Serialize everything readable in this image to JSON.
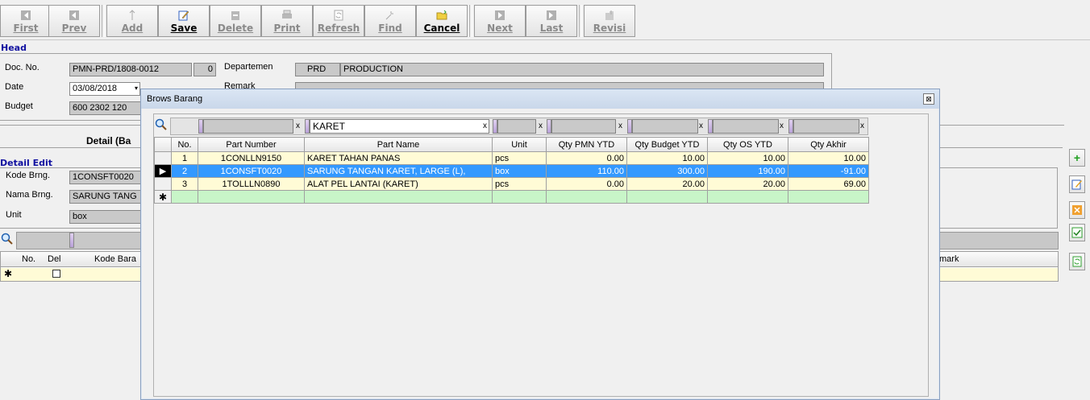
{
  "toolbar": {
    "buttons": [
      {
        "label": "First",
        "active": false
      },
      {
        "label": "Prev",
        "active": false
      },
      {
        "label": "Add",
        "active": false
      },
      {
        "label": "Save",
        "active": true
      },
      {
        "label": "Delete",
        "active": false
      },
      {
        "label": "Print",
        "active": false
      },
      {
        "label": "Refresh",
        "active": false
      },
      {
        "label": "Find",
        "active": false
      },
      {
        "label": "Cancel",
        "active": true
      },
      {
        "label": "Next",
        "active": false
      },
      {
        "label": "Last",
        "active": false
      },
      {
        "label": "Revisi",
        "active": false
      }
    ]
  },
  "head": {
    "section_title": "Head",
    "doc_no_label": "Doc. No.",
    "doc_no_value": "PMN-PRD/1808-0012",
    "doc_no_rev": "0",
    "date_label": "Date",
    "date_value": "03/08/2018",
    "budget_label": "Budget",
    "budget_value": "600 2302 120",
    "departemen_label": "Departemen",
    "departemen_code": "PRD",
    "departemen_name": "PRODUCTION",
    "remark_label": "Remark"
  },
  "detail": {
    "tab_label": "Detail (Ba",
    "section_title": "Detail Edit",
    "kode_label": "Kode Brng.",
    "kode_value": "1CONSFT0020",
    "nama_label": "Nama Brng.",
    "nama_value": "SARUNG TANG",
    "unit_label": "Unit",
    "unit_value": "box",
    "grid_headers": {
      "no": "No.",
      "del": "Del",
      "kode": "Kode Bara",
      "remark": "mark"
    }
  },
  "dialog": {
    "title": "Brows Barang",
    "close_glyph": "⊠",
    "filter_text": "KARET",
    "columns": [
      "No.",
      "Part Number",
      "Part Name",
      "Unit",
      "Qty PMN YTD",
      "Qty Budget YTD",
      "Qty OS YTD",
      "Qty Akhir"
    ],
    "rows": [
      {
        "no": "1",
        "part_number": "1CONLLN9150",
        "part_name": "KARET TAHAN PANAS",
        "unit": "pcs",
        "qty_pmn": "0.00",
        "qty_budget": "10.00",
        "qty_os": "10.00",
        "qty_akhir": "10.00",
        "selected": false
      },
      {
        "no": "2",
        "part_number": "1CONSFT0020",
        "part_name": "SARUNG TANGAN KARET, LARGE (L),",
        "unit": "box",
        "qty_pmn": "110.00",
        "qty_budget": "300.00",
        "qty_os": "190.00",
        "qty_akhir": "-91.00",
        "selected": true
      },
      {
        "no": "3",
        "part_number": "1TOLLLN0890",
        "part_name": "ALAT PEL LANTAI (KARET)",
        "unit": "pcs",
        "qty_pmn": "0.00",
        "qty_budget": "20.00",
        "qty_os": "20.00",
        "qty_akhir": "69.00",
        "selected": false
      }
    ]
  },
  "icons": {
    "new_row": "✱",
    "current_row": "▶",
    "filter_clear": "x"
  }
}
